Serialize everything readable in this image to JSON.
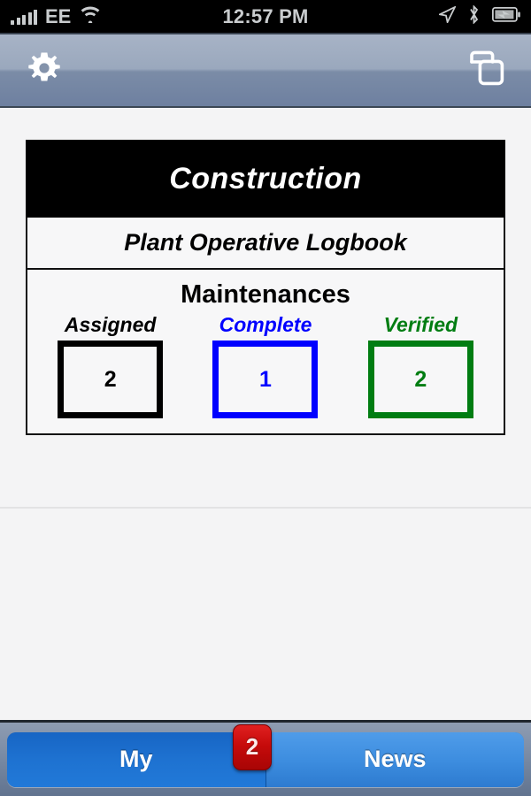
{
  "status_bar": {
    "carrier": "EE",
    "time": "12:57 PM",
    "signal_bars": 5,
    "icons": [
      "signal-bars-icon",
      "wifi-icon",
      "location-arrow-icon",
      "bluetooth-icon",
      "battery-charging-icon"
    ]
  },
  "nav_bar": {
    "left_icon": "gear-icon",
    "right_icon": "copy-duplicate-icon"
  },
  "card": {
    "title": "Construction",
    "subtitle": "Plant Operative Logbook",
    "panel_title": "Maintenances",
    "stats": [
      {
        "label": "Assigned",
        "value": "2",
        "color": "#000000"
      },
      {
        "label": "Complete",
        "value": "1",
        "color": "#0000ff"
      },
      {
        "label": "Verified",
        "value": "2",
        "color": "#007d12"
      }
    ]
  },
  "toolbar": {
    "segments": [
      {
        "label": "My",
        "selected": true
      },
      {
        "label": "News",
        "selected": false
      }
    ],
    "badge_count": "2",
    "badge_color": "#c60b0b",
    "selected_color": "#1e72d1",
    "unselected_color": "#3d8ddf"
  }
}
